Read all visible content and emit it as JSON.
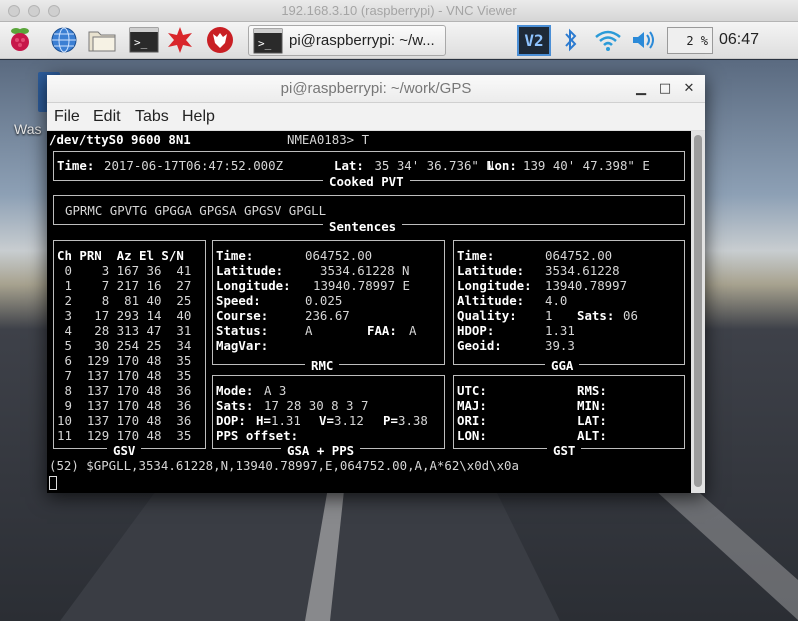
{
  "mac_window": {
    "title": "192.168.3.10 (raspberrypi) - VNC Viewer"
  },
  "panel": {
    "task_label": "pi@raspberrypi: ~/w...",
    "vnc_icon_text": "V2",
    "cpu": "2 %",
    "clock": "06:47",
    "icons": [
      "raspberry-menu-icon",
      "web-browser-icon",
      "file-manager-icon",
      "terminal-icon",
      "mathematica-icon",
      "wolfram-icon",
      "bluetooth-icon",
      "wifi-icon",
      "volume-icon"
    ]
  },
  "desktop": {
    "label": "Was"
  },
  "terminal_window": {
    "title": "pi@raspberrypi: ~/work/GPS",
    "menu": [
      "File",
      "Edit",
      "Tabs",
      "Help"
    ]
  },
  "gps": {
    "header_device": "/dev/ttyS0 9600 8N1",
    "header_mode": "NMEA0183> T",
    "pvt": {
      "time_label": "Time:",
      "time": "2017-06-17T06:47:52.000Z",
      "lat_label": "Lat:",
      "lat": " 35 34' 36.736\" N",
      "lon_label": "Lon:",
      "lon": "139 40' 47.398\" E",
      "title": "Cooked PVT"
    },
    "sentences": {
      "list": "GPRMC GPVTG GPGGA GPGSA GPGSV GPGLL",
      "title": "Sentences"
    },
    "gsv": {
      "header": "Ch PRN  Az El S/N",
      "rows": [
        " 0    3 167 36  41",
        " 1    7 217 16  27",
        " 2    8  81 40  25",
        " 3   17 293 14  40",
        " 4   28 313 47  31",
        " 5   30 254 25  34",
        " 6  129 170 48  35",
        " 7  137 170 48  35",
        " 8  137 170 48  36",
        " 9  137 170 48  36",
        "10  137 170 48  36",
        "11  129 170 48  35"
      ],
      "title": "GSV"
    },
    "rmc": {
      "title": "RMC",
      "time_label": "Time:",
      "time": "064752.00",
      "lat_label": "Latitude:",
      "lat": "3534.61228 N",
      "lon_label": "Longitude:",
      "lon": "13940.78997 E",
      "speed_label": "Speed:",
      "speed": "0.025",
      "course_label": "Course:",
      "course": "236.67",
      "status_label": "Status:",
      "status": "A",
      "faa_label": "FAA:",
      "faa": "A",
      "magvar_label": "MagVar:",
      "magvar": ""
    },
    "gga": {
      "title": "GGA",
      "time_label": "Time:",
      "time": "064752.00",
      "lat_label": "Latitude:",
      "lat": "3534.61228",
      "lon_label": "Longitude:",
      "lon": "13940.78997",
      "alt_label": "Altitude:",
      "alt": "4.0",
      "quality_label": "Quality:",
      "quality": "1",
      "sats_label": "Sats:",
      "sats": "06",
      "hdop_label": "HDOP:",
      "hdop": "1.31",
      "geoid_label": "Geoid:",
      "geoid": "39.3"
    },
    "gsa": {
      "title": "GSA + PPS",
      "mode_label": "Mode:",
      "mode": "A 3",
      "sats_label": "Sats:",
      "sats": "17 28 30 8 3 7",
      "dop_label": "DOP:",
      "h_label": "H=",
      "h": "1.31",
      "v_label": "V=",
      "v": "3.12",
      "p_label": "P=",
      "p": "3.38",
      "pps_label": "PPS offset:"
    },
    "gst": {
      "title": "GST",
      "utc_label": "UTC:",
      "rms_label": "RMS:",
      "maj_label": "MAJ:",
      "min_label": "MIN:",
      "ori_label": "ORI:",
      "lat_label": "LAT:",
      "lon_label": "LON:",
      "alt_label": "ALT:"
    },
    "raw_line": "(52) $GPGLL,3534.61228,N,13940.78997,E,064752.00,A,A*62\\x0d\\x0a"
  }
}
